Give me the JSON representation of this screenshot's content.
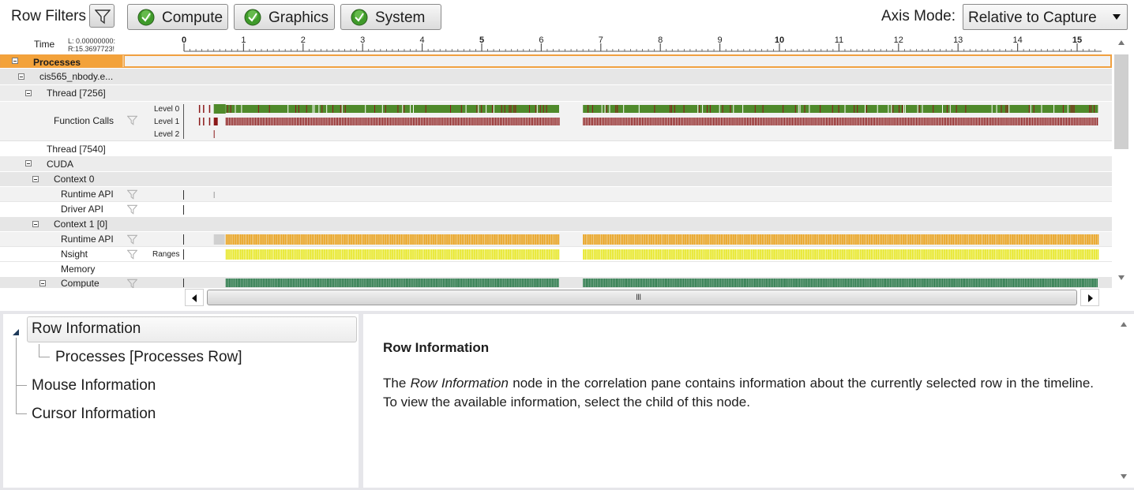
{
  "toolbar": {
    "row_filters_label": "Row Filters",
    "filter_buttons": [
      {
        "label": "Compute",
        "checked": true
      },
      {
        "label": "Graphics",
        "checked": true
      },
      {
        "label": "System",
        "checked": true
      }
    ],
    "axis_mode_label": "Axis Mode:",
    "axis_mode_value": "Relative to Capture"
  },
  "ruler": {
    "time_label": "Time",
    "left_value": "L: 0.00000000:",
    "right_value": "R:15.3697723!",
    "ticks": [
      "0",
      "1",
      "2",
      "3",
      "4",
      "5",
      "6",
      "7",
      "8",
      "9",
      "10",
      "11",
      "12",
      "13",
      "14",
      "15"
    ],
    "bold_ticks": [
      "0",
      "5",
      "10",
      "15"
    ],
    "range_seconds": [
      0,
      15.3697723
    ]
  },
  "rows": {
    "processes": {
      "label": "Processes"
    },
    "process": {
      "label": "cis565_nbody.e..."
    },
    "thread_7256": {
      "label": "Thread [7256]"
    },
    "function_calls": {
      "label": "Function Calls",
      "levels": [
        "Level 0",
        "Level 1",
        "Level 2"
      ]
    },
    "thread_7540": {
      "label": "Thread [7540]"
    },
    "cuda": {
      "label": "CUDA"
    },
    "context0": {
      "label": "Context 0"
    },
    "ctx0_runtime": {
      "label": "Runtime API"
    },
    "ctx0_driver": {
      "label": "Driver API"
    },
    "context1": {
      "label": "Context 1 [0]"
    },
    "ctx1_runtime": {
      "label": "Runtime API"
    },
    "nsight": {
      "label": "Nsight",
      "sub_label": "Ranges"
    },
    "memory": {
      "label": "Memory"
    },
    "compute": {
      "label": "Compute"
    }
  },
  "activity": {
    "active_intervals_seconds": [
      [
        0.7,
        6.3
      ],
      [
        6.7,
        15.35
      ]
    ],
    "colors": {
      "function_level0": "#4f8a2b",
      "function_level1": "#8b1a1a",
      "runtime_api": "#e9a016",
      "nsight_ranges": "#e6e61e",
      "compute": "#2a7a4a",
      "selection": "#f3a23a"
    }
  },
  "correlation": {
    "tree": {
      "root": "Row Information",
      "child": "Processes [Processes Row]",
      "siblings": [
        "Mouse Information",
        "Cursor Information"
      ]
    },
    "info": {
      "title": "Row Information",
      "body_pre": "The ",
      "body_em": "Row Information",
      "body_post": " node in the correlation pane contains information about the currently selected row in the timeline. To view the available information, select the child of this node."
    }
  }
}
